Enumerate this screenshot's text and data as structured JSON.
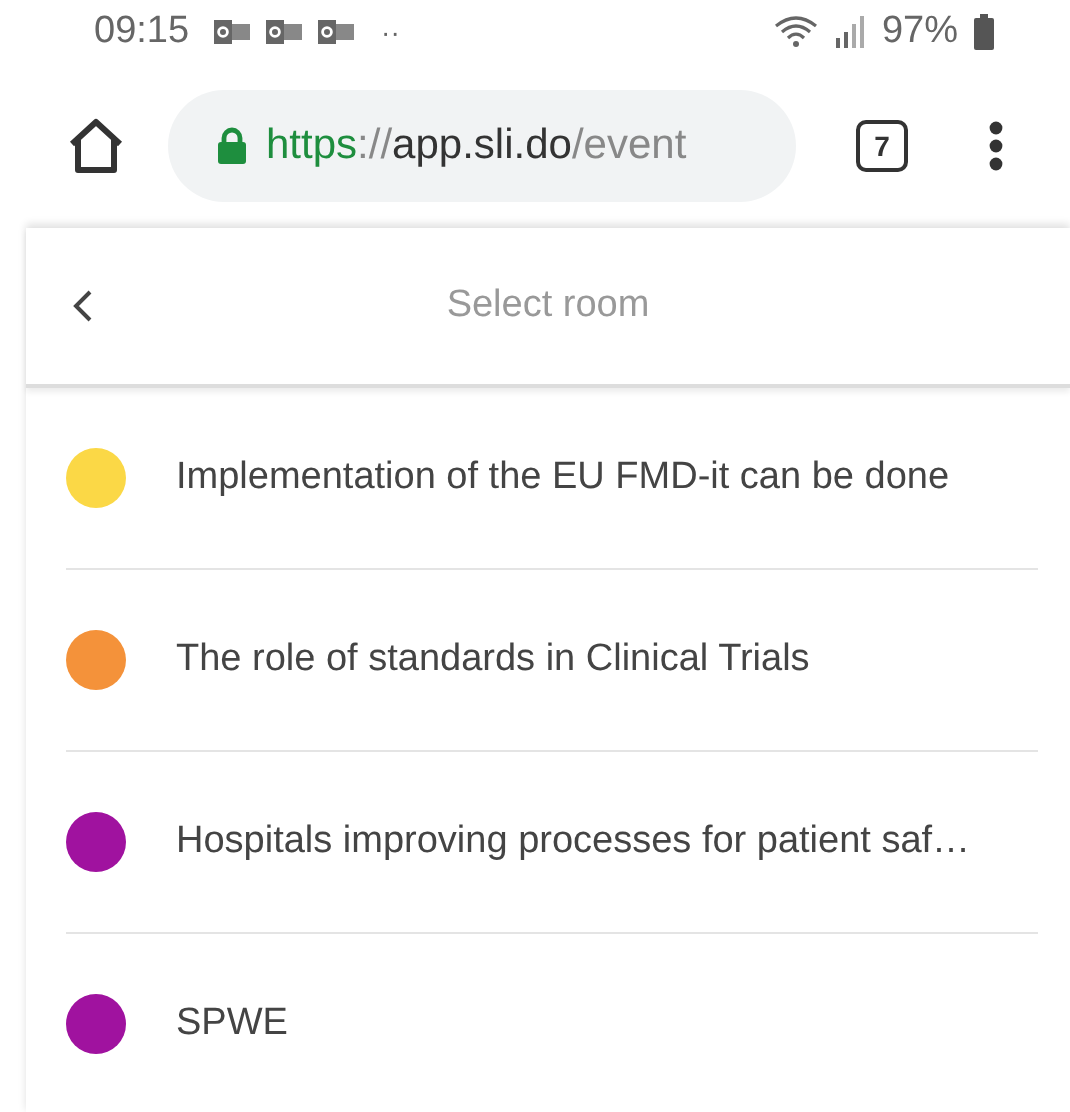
{
  "status_bar": {
    "time": "09:15",
    "notification_count": "··",
    "battery": "97%"
  },
  "browser": {
    "url_parts": [
      {
        "kind": "scheme",
        "text": "https"
      },
      {
        "kind": "separator",
        "text": "://"
      },
      {
        "kind": "host",
        "text": "app.sli.do"
      },
      {
        "kind": "path",
        "text": "/event"
      }
    ],
    "tab_count": "7"
  },
  "header": {
    "title": "Select room"
  },
  "rooms": [
    {
      "name": "Implementation of the EU FMD-it can be done",
      "color": "#fbd846"
    },
    {
      "name": "The role of standards in Clinical Trials",
      "color": "#f4923a"
    },
    {
      "name": "Hospitals improving processes for patient saf…",
      "color": "#a0129f"
    },
    {
      "name": "SPWE",
      "color": "#a0129f"
    }
  ]
}
